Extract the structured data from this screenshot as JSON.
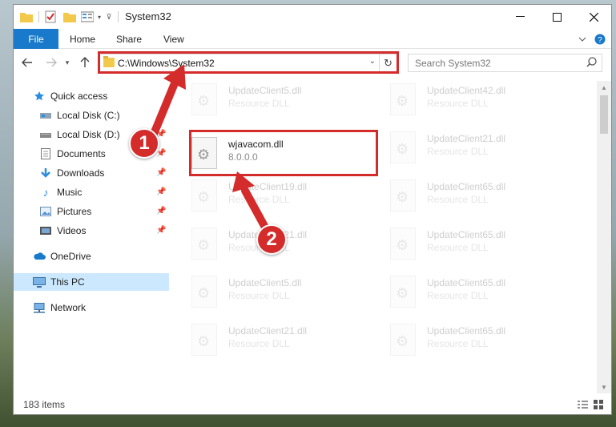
{
  "window": {
    "title": "System32",
    "controls": [
      "minimize",
      "maximize",
      "close"
    ]
  },
  "ribbon": {
    "tabs": [
      "File",
      "Home",
      "Share",
      "View"
    ]
  },
  "nav": {
    "address": "C:\\Windows\\System32",
    "search_placeholder": "Search System32"
  },
  "sidebar": {
    "items": [
      {
        "label": "Quick access",
        "icon": "star-icon",
        "pinned": false
      },
      {
        "label": "Local Disk (C:)",
        "icon": "drive-icon",
        "pinned": false
      },
      {
        "label": "Local Disk (D:)",
        "icon": "drive-icon",
        "pinned": true
      },
      {
        "label": "Documents",
        "icon": "document-icon",
        "pinned": true
      },
      {
        "label": "Downloads",
        "icon": "download-icon",
        "pinned": true
      },
      {
        "label": "Music",
        "icon": "music-icon",
        "pinned": true
      },
      {
        "label": "Pictures",
        "icon": "picture-icon",
        "pinned": true
      },
      {
        "label": "Videos",
        "icon": "video-icon",
        "pinned": true
      },
      {
        "label": "OneDrive",
        "icon": "cloud-icon",
        "pinned": false
      },
      {
        "label": "This PC",
        "icon": "computer-icon",
        "pinned": false,
        "selected": true
      },
      {
        "label": "Network",
        "icon": "network-icon",
        "pinned": false
      }
    ]
  },
  "files": {
    "left_column": [
      {
        "name": "UpdateClient5.dll",
        "desc": "Resource DLL",
        "faded": true
      },
      {
        "name": "wjavacom.dll",
        "desc": "8.0.0.0",
        "faded": false,
        "highlighted": true
      },
      {
        "name": "UpdateClient19.dll",
        "desc": "Resource DLL",
        "faded": true
      },
      {
        "name": "UpdateClient21.dll",
        "desc": "Resource DLL",
        "faded": true
      },
      {
        "name": "UpdateClient5.dll",
        "desc": "Resource DLL",
        "faded": true
      },
      {
        "name": "UpdateClient21.dll",
        "desc": "Resource DLL",
        "faded": true
      }
    ],
    "right_column": [
      {
        "name": "UpdateClient42.dll",
        "desc": "Resource DLL",
        "faded": true
      },
      {
        "name": "UpdateClient21.dll",
        "desc": "Resource DLL",
        "faded": true
      },
      {
        "name": "UpdateClient65.dll",
        "desc": "Resource DLL",
        "faded": true
      },
      {
        "name": "UpdateClient65.dll",
        "desc": "Resource DLL",
        "faded": true
      },
      {
        "name": "UpdateClient65.dll",
        "desc": "Resource DLL",
        "faded": true
      },
      {
        "name": "UpdateClient65.dll",
        "desc": "Resource DLL",
        "faded": true
      }
    ]
  },
  "status": {
    "item_count": "183 items"
  },
  "annotations": {
    "step1": "1",
    "step2": "2",
    "color": "#d42b2b"
  }
}
